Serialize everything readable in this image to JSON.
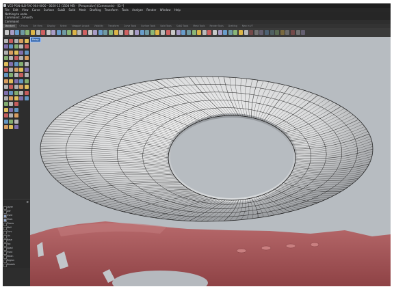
{
  "window": {
    "title": "VCS-PGN-4LB-FAC-004-0000 - 0020-13 (1508 MB) - [Perspective] (Commands) - [D:*]"
  },
  "menu": [
    "File",
    "Edit",
    "View",
    "Curve",
    "Surface",
    "SubD",
    "Solid",
    "Mesh",
    "Drafting",
    "Transform",
    "Tools",
    "Analyze",
    "Render",
    "Window",
    "Help"
  ],
  "command_history": [
    "Nothing to undo.",
    "Command: _Smooth"
  ],
  "command_prompt": "Command",
  "toolbar_tabs": [
    "Standard",
    "CPlanes",
    "Set View",
    "Display",
    "Select",
    "Viewport Layout",
    "Visibility",
    "Transform",
    "Curve Tools",
    "Surface Tools",
    "Solid Tools",
    "SubD Tools",
    "Mesh Tools",
    "Render Tools",
    "Drafting",
    "New in V7"
  ],
  "viewport": {
    "label": "Persp"
  },
  "layers": {
    "items": [
      {
        "name": "Layer",
        "checked": false
      },
      {
        "name": "Def",
        "checked": false
      },
      {
        "name": "Used",
        "checked": true
      },
      {
        "name": "Mesh",
        "checked": true
      },
      {
        "name": "Pieces",
        "checked": false
      },
      {
        "name": "Wall",
        "checked": false
      },
      {
        "name": "Curv",
        "checked": false
      },
      {
        "name": "Lin",
        "checked": false
      },
      {
        "name": "Base",
        "checked": false
      },
      {
        "name": "Top",
        "checked": false
      },
      {
        "name": "Gpad",
        "checked": false
      },
      {
        "name": "Front",
        "checked": false
      },
      {
        "name": "Hiddn",
        "checked": false
      },
      {
        "name": "Region",
        "checked": false
      },
      {
        "name": "Disable",
        "checked": false
      }
    ]
  },
  "colors": {
    "viewport_bg": "#b7bcc1",
    "terrain": "#a8575a",
    "torus_face": "#e3e4e5",
    "panel_bg": "#2b2b2b",
    "active_tab": "#474747",
    "viewport_label": "#3f6fb0"
  }
}
